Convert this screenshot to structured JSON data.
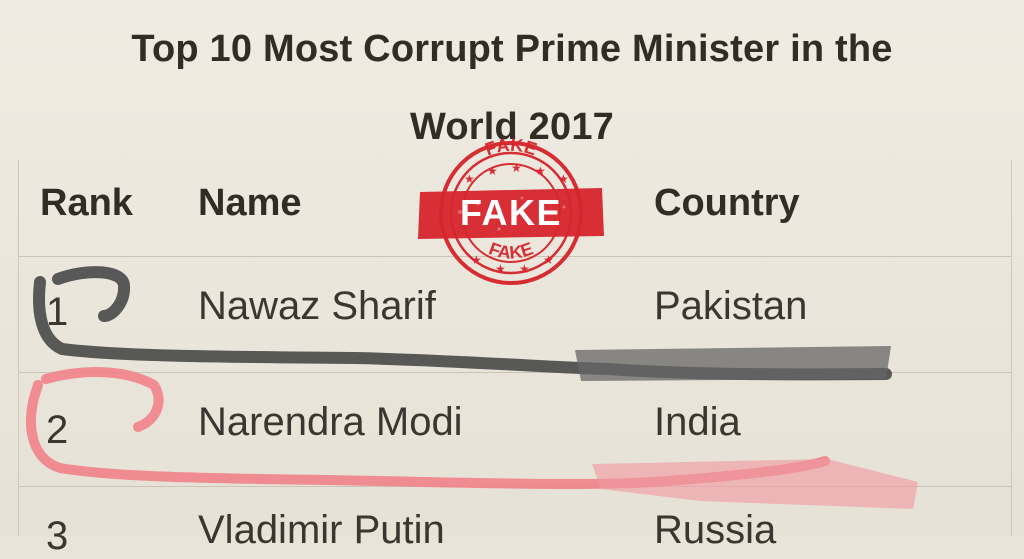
{
  "title": "Top 10 Most Corrupt Prime Minister in the\nWorld 2017",
  "stamp": {
    "top_text": "FAKE",
    "center_text": "FAKE",
    "bottom_text": "FAKE",
    "color": "#d6262d"
  },
  "table": {
    "headers": {
      "rank": "Rank",
      "name": "Name",
      "country": "Country"
    },
    "rows": [
      {
        "rank": "1",
        "name": "Nawaz Sharif",
        "country": "Pakistan"
      },
      {
        "rank": "2",
        "name": "Narendra Modi",
        "country": "India"
      },
      {
        "rank": "3",
        "name": "Vladimir Putin",
        "country": "Russia"
      }
    ]
  },
  "markers": {
    "black": "#505050",
    "pink": "#f07f88"
  }
}
